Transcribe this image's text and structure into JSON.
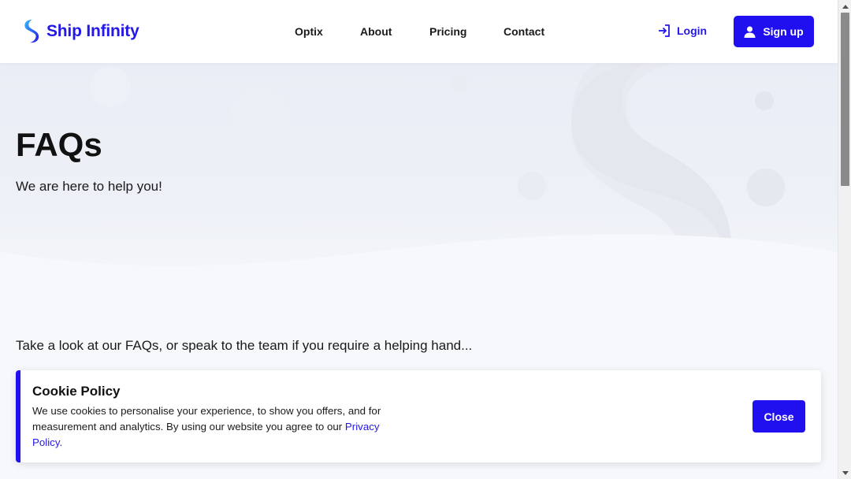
{
  "header": {
    "logo_text": "Ship Infinity",
    "nav": [
      {
        "label": "Optix"
      },
      {
        "label": "About"
      },
      {
        "label": "Pricing"
      },
      {
        "label": "Contact"
      }
    ],
    "login_label": "Login",
    "signup_label": "Sign up"
  },
  "hero": {
    "title": "FAQs",
    "subtitle": "We are here to help you!"
  },
  "intro": "Take a look at our FAQs, or speak to the team if you require a helping hand...",
  "cookie": {
    "title": "Cookie Policy",
    "text": "We use cookies to personalise your experience, to show you offers, and for measurement and analytics. By using our website you agree to our ",
    "link_label": "Privacy Policy.",
    "close_label": "Close"
  },
  "colors": {
    "brand": "#2418e6",
    "button": "#2010f0",
    "hero_bg": "#eef1f7"
  },
  "icons": {
    "logo": "ship-infinity-logo-icon",
    "login": "login-arrow-icon",
    "signup": "user-icon"
  }
}
